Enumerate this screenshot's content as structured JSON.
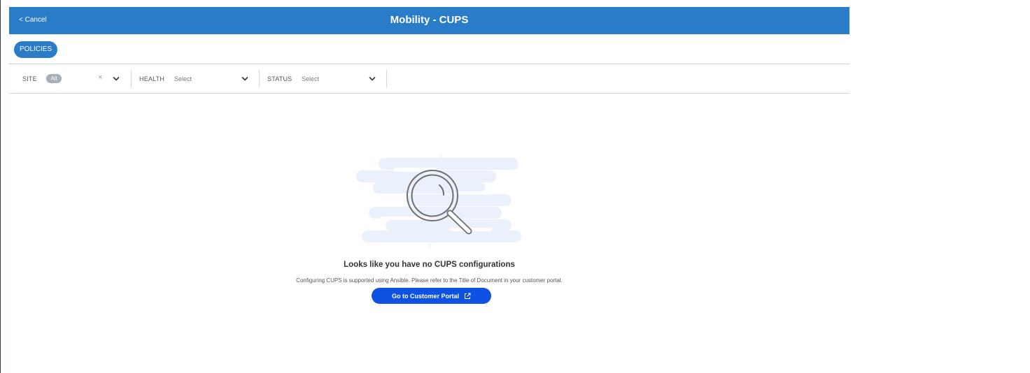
{
  "header": {
    "cancel_label": "< Cancel",
    "title": "Mobility - CUPS"
  },
  "toolbar": {
    "policies_label": "POLICIES"
  },
  "filters": {
    "site": {
      "label": "SITE",
      "chip": "All"
    },
    "health": {
      "label": "HEALTH",
      "value": "Select"
    },
    "status": {
      "label": "STATUS",
      "value": "Select"
    }
  },
  "empty_state": {
    "title": "Looks like you have no CUPS configurations",
    "subtitle": "Configuring CUPS is supported using Ansible. Please refer to the Title of Document in your customer portal.",
    "button_label": "Go to Customer Portal"
  },
  "icons": [
    "chevron-down-icon",
    "close-icon",
    "magnifier-icon",
    "external-link-icon"
  ],
  "colors": {
    "header": "#2a7bc8",
    "primary_button": "#0d52e3",
    "illustration_bg": "#eaf1fc"
  }
}
